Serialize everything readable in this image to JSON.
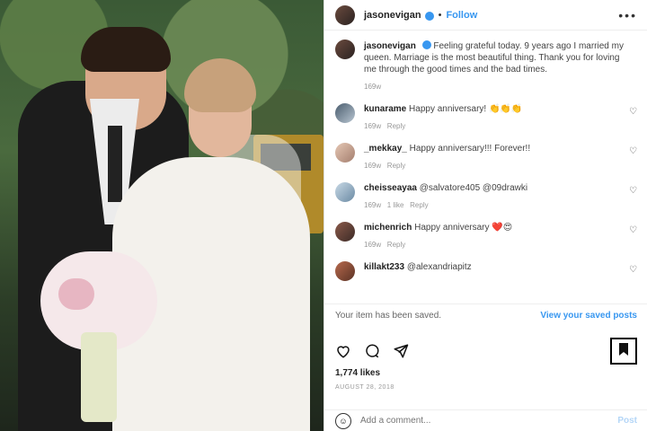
{
  "header": {
    "username": "jasonevigan",
    "separator": "•",
    "follow_label": "Follow",
    "more_label": "•••"
  },
  "caption": {
    "username": "jasonevigan",
    "text": "Feeling grateful today. 9 years ago I married my queen. Marriage is the most beautiful thing. Thank you for loving me through the good times and the bad times.",
    "time": "169w"
  },
  "comments": [
    {
      "username": "kunarame",
      "text": "Happy anniversary! 👏👏👏",
      "time": "169w",
      "reply": "Reply"
    },
    {
      "username": "_mekkay_",
      "text": "Happy anniversary!!! Forever!!",
      "time": "169w",
      "reply": "Reply"
    },
    {
      "username": "cheisseayaa",
      "text": "@salvatore405 @09drawki",
      "time": "169w",
      "likes": "1 like",
      "reply": "Reply"
    },
    {
      "username": "michenrich",
      "text": "Happy anniversary ❤️😍",
      "time": "169w",
      "reply": "Reply"
    },
    {
      "username": "killakt233",
      "text": "@alexandriapitz",
      "time": "",
      "reply": ""
    }
  ],
  "saved": {
    "message": "Your item has been saved.",
    "link": "View your saved posts"
  },
  "stats": {
    "likes": "1,774 likes",
    "date": "AUGUST 28, 2018"
  },
  "comment_box": {
    "placeholder": "Add a comment...",
    "post_label": "Post"
  },
  "icons": [
    "heart-icon",
    "comment-icon",
    "share-icon",
    "bookmark-icon",
    "emoji-icon",
    "more-icon"
  ],
  "colors": {
    "link": "#3897f0",
    "post_disabled": "#b4d6f7"
  }
}
